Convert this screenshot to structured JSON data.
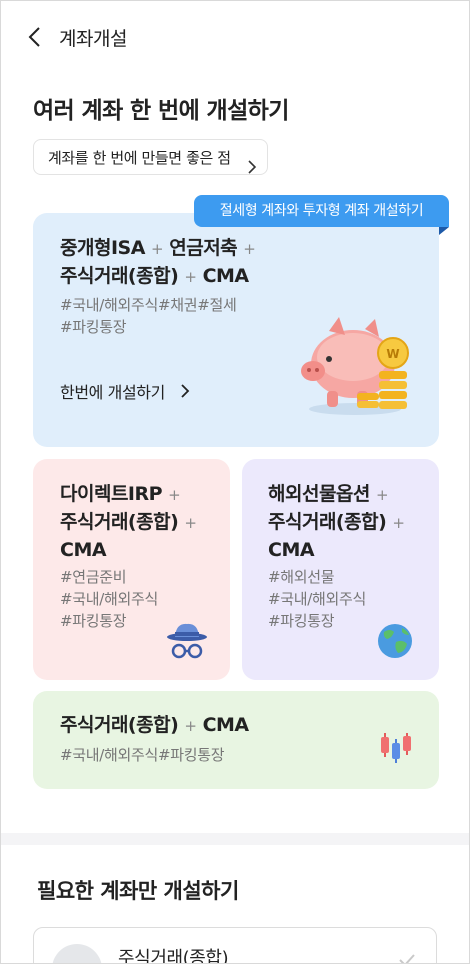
{
  "header": {
    "title": "계좌개설"
  },
  "section1": {
    "title": "여러 계좌 한 번에 개설하기",
    "info_pill": "계좌를 한 번에 만들면 좋은 점"
  },
  "featured_card": {
    "ribbon": "절세형 계좌와 투자형 계좌 개설하기",
    "line1_a": "중개형ISA",
    "line1_b": "연금저축",
    "line2_a": "주식거래(종합)",
    "line2_b": "CMA",
    "tags_line1": "#국내/해외주식#채권#절세",
    "tags_line2": "#파킹통장",
    "cta": "한번에 개설하기"
  },
  "irp_card": {
    "line1": "다이렉트IRP",
    "line2": "주식거래(종합)",
    "line3": "CMA",
    "tags": [
      "#연금준비",
      "#국내/해외주식",
      "#파킹통장"
    ]
  },
  "futures_card": {
    "line1": "해외선물옵션",
    "line2": "주식거래(종합)",
    "line3": "CMA",
    "tags": [
      "#해외선물",
      "#국내/해외주식",
      "#파킹통장"
    ]
  },
  "cma_card": {
    "line1_a": "주식거래(종합)",
    "line1_b": "CMA",
    "tags": "#국내/해외주식#파킹통장"
  },
  "plus_sign": "+",
  "section2": {
    "title": "필요한 계좌만 개설하기",
    "first_item": "주식거래(종합)"
  },
  "colors": {
    "ribbon": "#3d9bf0",
    "featured_bg": "#e0eefb",
    "irp_bg": "#fde9e9",
    "futures_bg": "#ece9fc",
    "cma_bg": "#e8f5e2"
  },
  "icons": [
    "back-arrow-icon",
    "chevron-right-icon",
    "piggy-bank-coins-icon",
    "detective-hat-glasses-icon",
    "globe-icon",
    "candlestick-chart-icon",
    "checkmark-icon"
  ]
}
